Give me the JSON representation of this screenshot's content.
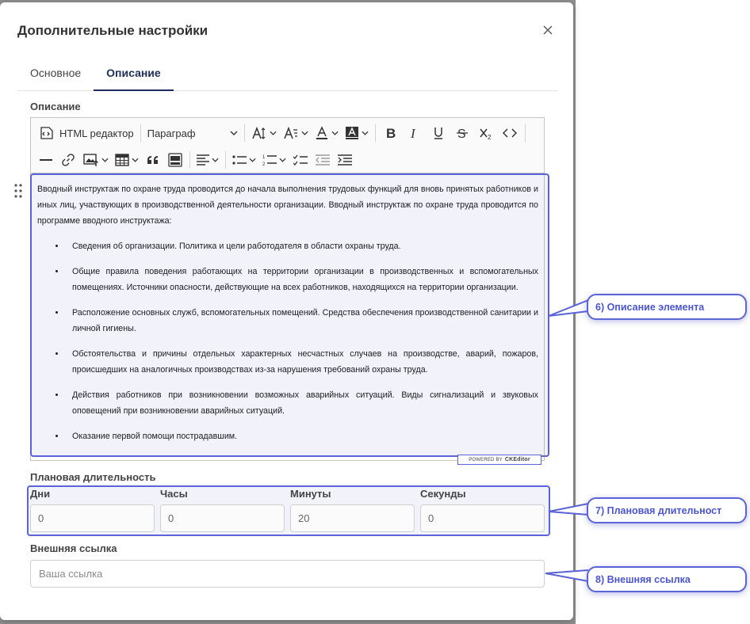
{
  "modal": {
    "title": "Дополнительные настройки",
    "tabs": [
      {
        "label": "Основное",
        "active": false
      },
      {
        "label": "Описание",
        "active": true
      }
    ]
  },
  "description": {
    "label": "Описание",
    "toolbar": {
      "html_editor_label": "HTML редактор",
      "heading_select": "Параграф"
    },
    "content": {
      "intro": "Вводный инструктаж по охране труда проводится до начала выполнения трудовых функций для вновь принятых работников и иных лиц, участвующих в производственной деятельности организации. Вводный инструктаж по охране труда проводится по программе вводного инструктажа:",
      "items": [
        "Сведения об организации. Политика и цели работодателя в области охраны труда.",
        "Общие правила поведения работающих на территории организации в производственных и вспомогательных помещениях. Источники опасности, действующие на всех работников, находящихся на территории организации.",
        "Расположение основных служб, вспомогательных помещений. Средства обеспечения производственной санитарии и личной гигиены.",
        "Обстоятельства и причины отдельных характерных несчастных случаев на производстве, аварий, пожаров, происшедших на аналогичных производствах из-за нарушения требований охраны труда.",
        "Действия работников при возникновении возможных аварийных ситуаций. Виды сигнализаций и звуковых оповещений при возникновении аварийных ситуаций.",
        "Оказание первой помощи пострадавшим."
      ]
    },
    "powered_by": "POWERED BY",
    "ckeditor": "CKEditor"
  },
  "duration": {
    "label": "Плановая длительность",
    "fields": [
      {
        "label": "Дни",
        "value": "0"
      },
      {
        "label": "Часы",
        "value": "0"
      },
      {
        "label": "Минуты",
        "value": "20"
      },
      {
        "label": "Секунды",
        "value": "0"
      }
    ]
  },
  "external_link": {
    "label": "Внешняя ссылка",
    "placeholder": "Ваша ссылка"
  },
  "callouts": [
    "6) Описание элемента",
    "7)  Плановая длительност",
    "8) Внешняя ссылка"
  ],
  "colors": {
    "accent": "#5b63d8",
    "active_tab": "#1f2d5a"
  }
}
